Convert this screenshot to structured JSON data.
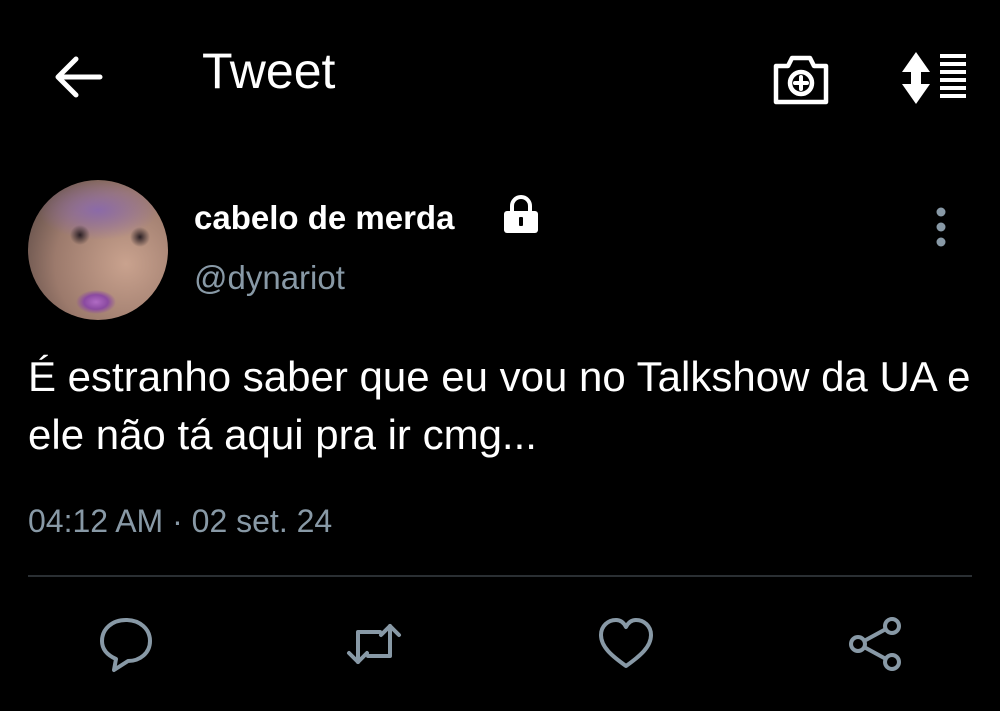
{
  "header": {
    "title": "Tweet",
    "back_icon": "arrow-left-icon",
    "camera_icon": "camera-plus-icon",
    "sort_icon": "sort-list-icon"
  },
  "tweet": {
    "author_name": "cabelo de merda",
    "author_handle": "@dynariot",
    "protected_icon": "lock-icon",
    "more_icon": "more-vertical-icon",
    "text": "É estranho saber que eu vou no Talkshow da UA e ele não tá aqui pra ir cmg...",
    "timestamp": "04:12 AM · 02 set. 24"
  },
  "actions": {
    "reply_icon": "reply-icon",
    "retweet_icon": "retweet-icon",
    "like_icon": "heart-icon",
    "share_icon": "share-icon"
  },
  "colors": {
    "background": "#000000",
    "text_primary": "#ffffff",
    "text_secondary": "#8899a6",
    "icon": "#8899a6",
    "divider": "#2a2f33"
  }
}
